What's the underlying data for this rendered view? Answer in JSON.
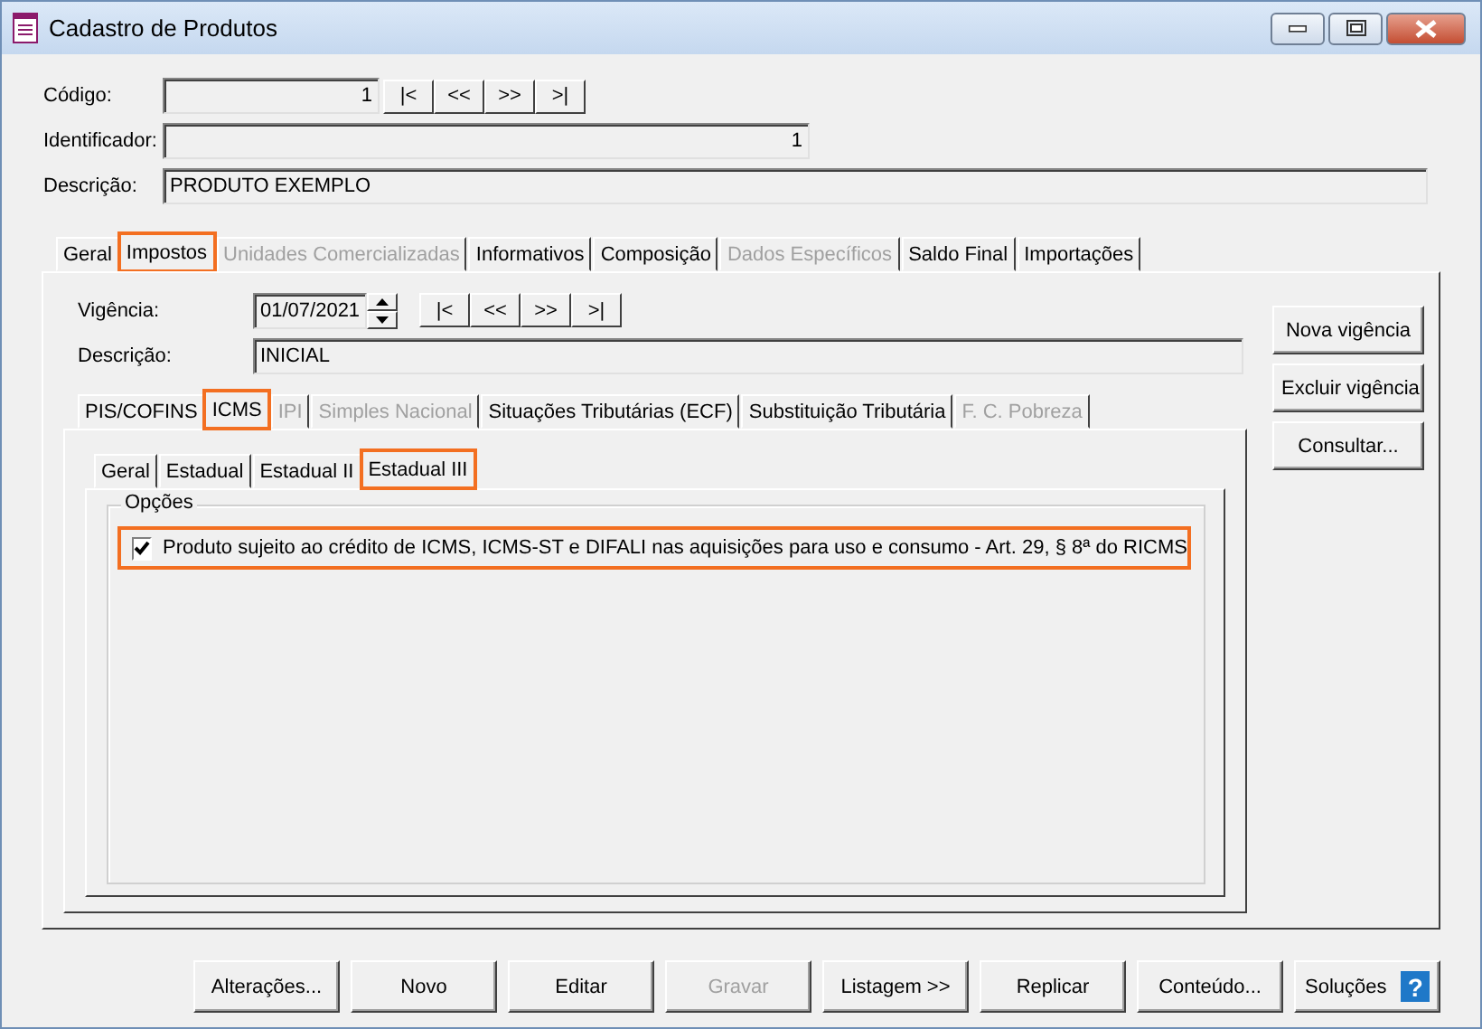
{
  "window": {
    "title": "Cadastro de Produtos"
  },
  "header_fields": [
    {
      "label": "Código:",
      "value": "1",
      "kind": "number",
      "nav": [
        "|<",
        "<<",
        ">>",
        ">|"
      ]
    },
    {
      "label": "Identificador:",
      "value": "1",
      "kind": "number"
    },
    {
      "label": "Descrição:",
      "value": "PRODUTO EXEMPLO",
      "kind": "text"
    }
  ],
  "main_tabs": [
    {
      "label": "Geral",
      "selected": false,
      "disabled": false,
      "highlighted": false
    },
    {
      "label": "Impostos",
      "selected": true,
      "disabled": false,
      "highlighted": true
    },
    {
      "label": "Unidades Comercializadas",
      "selected": false,
      "disabled": true,
      "highlighted": false
    },
    {
      "label": "Informativos",
      "selected": false,
      "disabled": false,
      "highlighted": false
    },
    {
      "label": "Composição",
      "selected": false,
      "disabled": false,
      "highlighted": false
    },
    {
      "label": "Dados Específicos",
      "selected": false,
      "disabled": true,
      "highlighted": false
    },
    {
      "label": "Saldo Final",
      "selected": false,
      "disabled": false,
      "highlighted": false
    },
    {
      "label": "Importações",
      "selected": false,
      "disabled": false,
      "highlighted": false
    }
  ],
  "vigencia": {
    "label": "Vigência:",
    "value": "01/07/2021",
    "nav": [
      "|<",
      "<<",
      ">>",
      ">|"
    ]
  },
  "vigencia_descricao": {
    "label": "Descrição:",
    "value": "INICIAL"
  },
  "side_buttons": [
    "Nova vigência",
    "Excluir vigência",
    "Consultar..."
  ],
  "tax_tabs": [
    {
      "label": "PIS/COFINS",
      "selected": false,
      "disabled": false,
      "highlighted": false
    },
    {
      "label": "ICMS",
      "selected": true,
      "disabled": false,
      "highlighted": true
    },
    {
      "label": "IPI",
      "selected": false,
      "disabled": true,
      "highlighted": false
    },
    {
      "label": "Simples Nacional",
      "selected": false,
      "disabled": true,
      "highlighted": false
    },
    {
      "label": "Situações Tributárias (ECF)",
      "selected": false,
      "disabled": false,
      "highlighted": false
    },
    {
      "label": "Substituição Tributária",
      "selected": false,
      "disabled": false,
      "highlighted": false
    },
    {
      "label": "F. C. Pobreza",
      "selected": false,
      "disabled": true,
      "highlighted": false
    }
  ],
  "icms_tabs": [
    {
      "label": "Geral",
      "selected": false,
      "disabled": false,
      "highlighted": false
    },
    {
      "label": "Estadual",
      "selected": false,
      "disabled": false,
      "highlighted": false
    },
    {
      "label": "Estadual II",
      "selected": false,
      "disabled": false,
      "highlighted": false
    },
    {
      "label": "Estadual III",
      "selected": true,
      "disabled": false,
      "highlighted": true
    }
  ],
  "options_group": {
    "title": "Opções",
    "options": [
      {
        "label": "Produto sujeito ao crédito de ICMS, ICMS-ST e DIFALI nas aquisições para uso e consumo - Art. 29, § 8ª do RICMS",
        "checked": true,
        "highlighted": true
      }
    ]
  },
  "footer_buttons": [
    {
      "label": "Alterações...",
      "disabled": false
    },
    {
      "label": "Novo",
      "disabled": false
    },
    {
      "label": "Editar",
      "disabled": false
    },
    {
      "label": "Gravar",
      "disabled": true
    },
    {
      "label": "Listagem >>",
      "disabled": false
    },
    {
      "label": "Replicar",
      "disabled": false
    },
    {
      "label": "Conteúdo...",
      "disabled": false
    }
  ],
  "help": {
    "label": "Soluções",
    "icon": "?"
  }
}
